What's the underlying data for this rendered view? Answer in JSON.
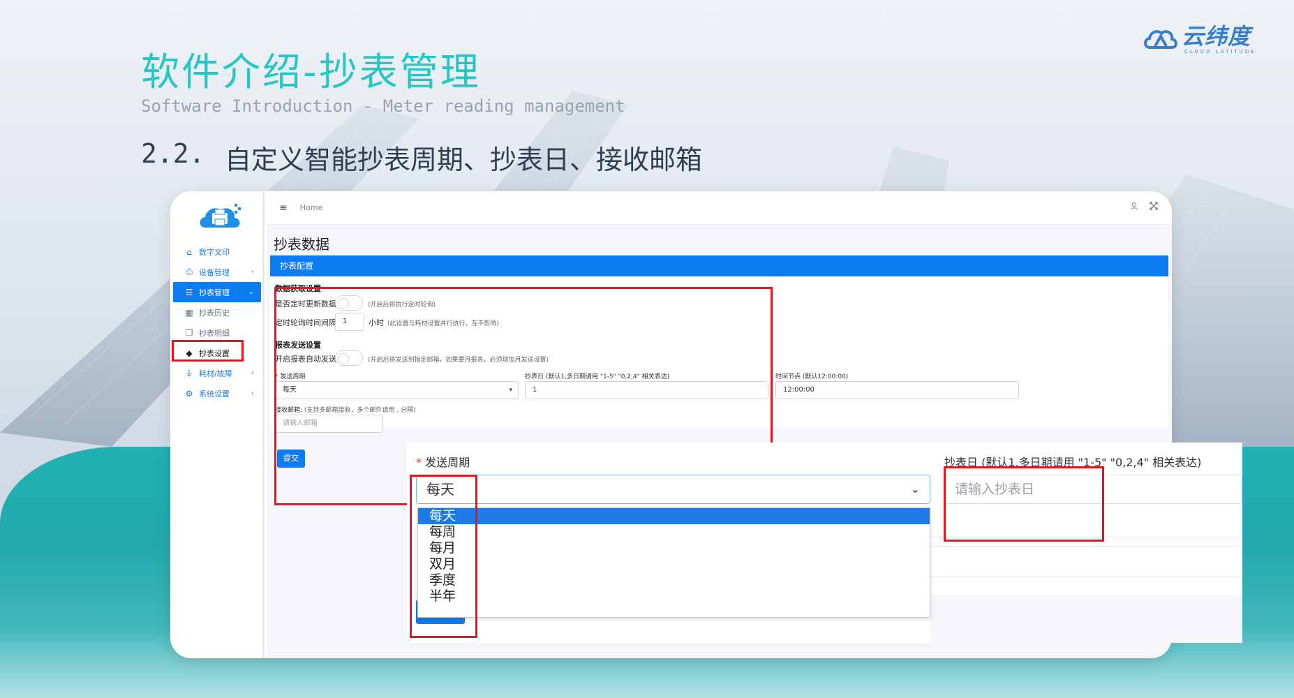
{
  "brand": {
    "name_cn": "云纬度",
    "name_en": "CLOUD LATITUDE"
  },
  "slide": {
    "title_cn": "软件介绍-抄表管理",
    "title_en": "Software Introduction - Meter reading management",
    "section_num": "2.2.",
    "section_text": "自定义智能抄表周期、抄表日、接收邮箱"
  },
  "app": {
    "topbar": {
      "menu_icon": "≡",
      "breadcrumb": "Home"
    },
    "sidebar": {
      "items": [
        {
          "label": "数字文印",
          "icon": "home-icon",
          "glyph": "⌂"
        },
        {
          "label": "设备管理",
          "icon": "printer-icon",
          "glyph": "⎙",
          "arrow": "‹"
        },
        {
          "label": "抄表管理",
          "icon": "list-icon",
          "glyph": "☰",
          "arrow": "⌄"
        },
        {
          "label": "抄表历史",
          "icon": "table-icon",
          "glyph": "▦"
        },
        {
          "label": "抄表明细",
          "icon": "copy-icon",
          "glyph": "❐"
        },
        {
          "label": "抄表设置",
          "icon": "tags-icon",
          "glyph": "◆"
        },
        {
          "label": "耗材/故障",
          "icon": "plug-icon",
          "glyph": "⏚",
          "arrow": "‹"
        },
        {
          "label": "系统设置",
          "icon": "cogs-icon",
          "glyph": "⚙",
          "arrow": "‹"
        }
      ]
    },
    "page_title": "抄表数据",
    "panel_title": "抄表配置",
    "form": {
      "section1": "数据获取设置",
      "auto_update_label": "是否定时更新数据:",
      "auto_update_hint": "(开启后将执行定时轮询)",
      "interval_label": "定时轮询时间间隔:",
      "interval_value": "1",
      "interval_unit": "小时",
      "interval_hint": "(此设置与耗材设置并行执行，互不影响)",
      "section2": "报表发送设置",
      "auto_send_label": "开启报表自动发送:",
      "auto_send_hint": "(开启后将发送到指定邮箱，如果要月报表，必须增加月发送设置)",
      "period_label": "发送周期",
      "period_value": "每天",
      "day_label": "抄表日 (默认1,多日期请用 \"1-5\" \"0,2,4\" 相关表达)",
      "day_value": "1",
      "time_label": "时间节点 (默认12:00:00)",
      "time_value": "12:00:00",
      "email_label": "接收邮箱:",
      "email_hint": "(支持多邮箱接收，多个邮件请用 , 分隔)",
      "email_placeholder": "请输入邮箱",
      "submit": "提交"
    }
  },
  "zoom": {
    "period_label": "发送周期",
    "period_value": "每天",
    "options": [
      "每天",
      "每周",
      "每月",
      "双月",
      "季度",
      "半年"
    ],
    "day_label": "抄表日 (默认1,多日期请用 \"1-5\" \"0,2,4\" 相关表达)",
    "day_placeholder": "请输入抄表日",
    "submit": "提交"
  }
}
